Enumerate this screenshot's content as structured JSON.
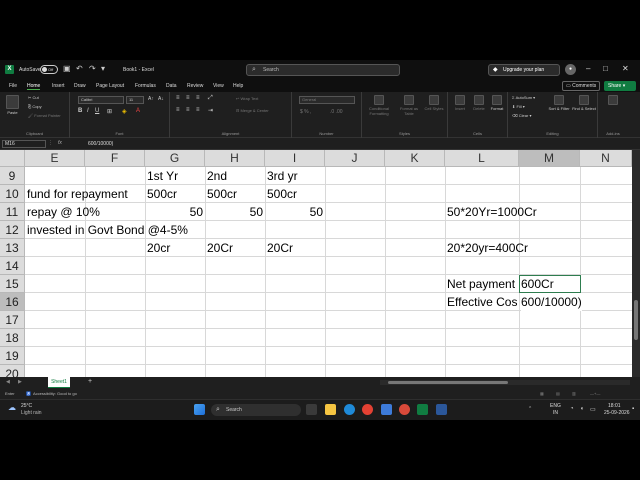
{
  "titlebar": {
    "autosave_label": "AutoSave",
    "autosave_state": "Off",
    "doc_title": "Book1 - Excel",
    "search_placeholder": "Search",
    "upgrade_label": "Upgrade your plan"
  },
  "menu": {
    "items": [
      "File",
      "Home",
      "Insert",
      "Draw",
      "Page Layout",
      "Formulas",
      "Data",
      "Review",
      "View",
      "Help"
    ],
    "active": "Home",
    "comments_label": "Comments",
    "share_label": "Share"
  },
  "ribbon": {
    "paste": "Paste",
    "cut": "Cut",
    "copy": "Copy",
    "format_painter": "Format Painter",
    "clipboard": "Clipboard",
    "font_name": "Calibri",
    "font_size": "11",
    "font": "Font",
    "wrap_text": "Wrap Text",
    "merge_center": "Merge & Center",
    "alignment": "Alignment",
    "number_format": "General",
    "number": "Number",
    "conditional_formatting": "Conditional Formatting",
    "format_as_table": "Format as Table",
    "cell_styles": "Cell Styles",
    "styles": "Styles",
    "insert": "Insert",
    "delete": "Delete",
    "format": "Format",
    "cells": "Cells",
    "autosum": "AutoSum",
    "fill": "Fill",
    "clear": "Clear",
    "sort_filter": "Sort & Filter",
    "find_select": "Find & Select",
    "editing": "Editing",
    "addins": "Add-ins"
  },
  "formula_bar": {
    "name_box": "M16",
    "fx": "fx",
    "formula": "600/10000)"
  },
  "grid": {
    "columns": [
      "E",
      "F",
      "G",
      "H",
      "I",
      "J",
      "K",
      "L",
      "M",
      "N"
    ],
    "selected_column": "M",
    "rows": [
      "9",
      "10",
      "11",
      "12",
      "13",
      "14",
      "15",
      "16",
      "17",
      "18",
      "19",
      "20"
    ],
    "selected_row": "16",
    "cells": {
      "G9": "1st Yr",
      "H9": "2nd",
      "I9": "3rd yr",
      "E10": "fund for repayment",
      "G10": "500cr",
      "H10": "500cr",
      "I10": "500cr",
      "E11": "repay @ 10%",
      "G11": "50",
      "H11": "50",
      "I11": "50",
      "L11": "50*20Yr=1000Cr",
      "E12": "invested in Govt Bond @4-5%",
      "G13": "20cr",
      "H13": "20Cr",
      "I13": "20Cr",
      "L13": "20*20yr=400Cr",
      "L15": "Net payment",
      "M15": "600Cr",
      "L16": "Effective Cos",
      "M16": "600/10000)"
    }
  },
  "sheets": {
    "tabs": [
      "Sheet1"
    ],
    "add_label": "+"
  },
  "status": {
    "mode": "Enter",
    "accessibility": "Accessibility: Good to go"
  },
  "taskbar": {
    "weather_temp": "25°C",
    "weather_desc": "Light rain",
    "search_label": "Search",
    "lang": "ENG",
    "region": "IN",
    "time": "18:01",
    "date": "25-09-2026"
  }
}
